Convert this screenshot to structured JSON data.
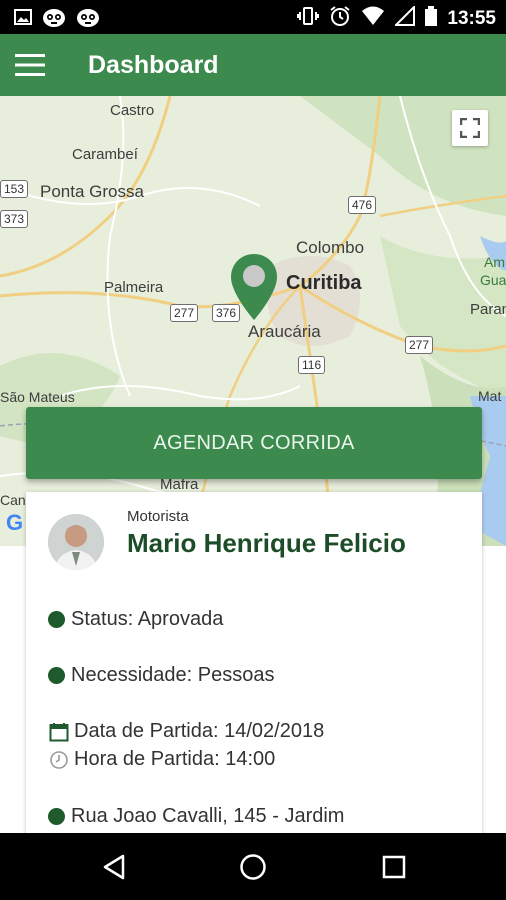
{
  "status_bar": {
    "time": "13:55",
    "left_icons": [
      "image-icon",
      "app-notification-icon",
      "app-notification-icon"
    ],
    "right_icons": [
      "vibrate-icon",
      "alarm-icon",
      "wifi-icon",
      "signal-icon",
      "battery-icon"
    ]
  },
  "app_bar": {
    "title": "Dashboard",
    "menu_icon": "hamburger-menu-icon"
  },
  "map": {
    "labels": {
      "castro": "Castro",
      "carambei": "Carambeí",
      "ponta_grossa": "Ponta Grossa",
      "colombo": "Colombo",
      "curitiba": "Curitiba",
      "palmeira": "Palmeira",
      "araucaria": "Araucária",
      "sao_mateus": "São Mateus",
      "mafra": "Mafra",
      "parana": "Parana",
      "mat": "Mat",
      "am": "Am",
      "gua": "Gua",
      "can": "Can",
      "google_g": "G"
    },
    "road_shields": {
      "r153": "153",
      "r373": "373",
      "r476": "476",
      "r277a": "277",
      "r376": "376",
      "r277b": "277",
      "r116": "116"
    },
    "pin_color": "#3c8a4e",
    "fullscreen_icon": "fullscreen-icon"
  },
  "schedule_button": {
    "label": "AGENDAR CORRIDA"
  },
  "driver_card": {
    "role": "Motorista",
    "name": "Mario Henrique Felicio",
    "status": "Status: Aprovada",
    "need": "Necessidade: Pessoas",
    "departure_date": "Data de Partida: 14/02/2018",
    "departure_time": "Hora de Partida: 14:00",
    "address": "Rua Joao Cavalli, 145 - Jardim"
  },
  "nav_bar": {
    "back_icon": "back-icon",
    "home_icon": "home-icon",
    "recents_icon": "recents-icon"
  },
  "colors": {
    "primary": "#3c8a4e",
    "dark_green": "#1c4d28"
  }
}
